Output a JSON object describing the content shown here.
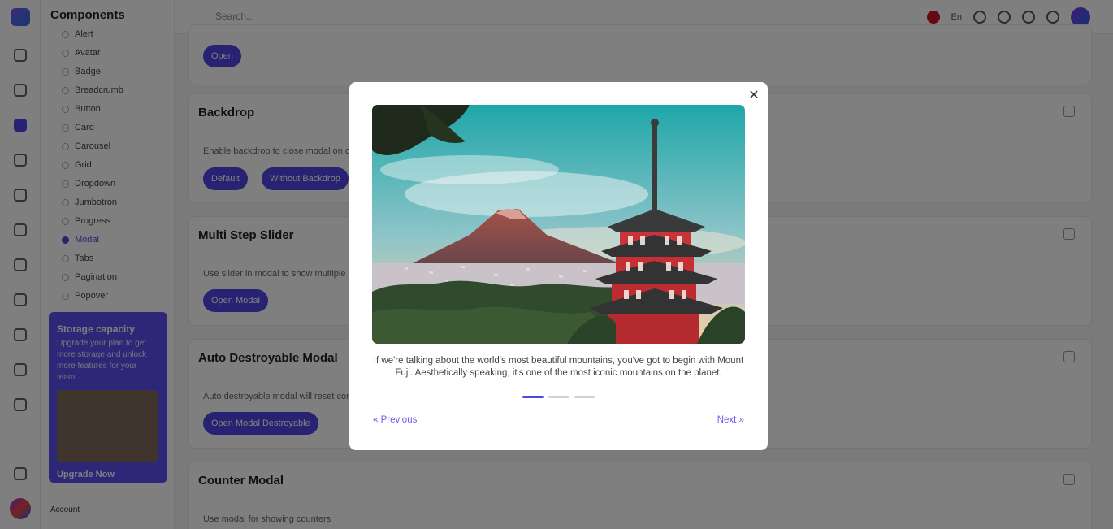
{
  "app": {
    "section_title": "Components"
  },
  "topbar": {
    "search_placeholder": "Search...",
    "language": "En"
  },
  "subnav": {
    "items": [
      "Alert",
      "Avatar",
      "Badge",
      "Breadcrumb",
      "Button",
      "Card",
      "Carousel",
      "Grid",
      "Dropdown",
      "Jumbotron",
      "Progress",
      "Modal",
      "Tabs",
      "Pagination",
      "Popover"
    ],
    "active_index": 11
  },
  "promo": {
    "title": "Storage capacity",
    "text": "Upgrade your plan to get more storage and unlock more features for your team.",
    "link": "Upgrade Now"
  },
  "profile": {
    "name": "Account"
  },
  "cards": [
    {
      "title": "",
      "desc": "",
      "buttons": [
        "Open"
      ]
    },
    {
      "title": "Backdrop",
      "desc": "Enable backdrop to close modal on outside click",
      "buttons": [
        "Default",
        "Without Backdrop"
      ]
    },
    {
      "title": "Multi Step Slider",
      "desc": "Use slider in modal to show multiple steps content",
      "buttons": [
        "Open Modal"
      ]
    },
    {
      "title": "Auto Destroyable Modal",
      "desc": "Auto destroyable modal will reset content on close",
      "buttons": [
        "Open Modal Destroyable"
      ]
    },
    {
      "title": "Counter Modal",
      "desc": "Use modal for showing counters",
      "buttons": []
    }
  ],
  "modal": {
    "close_icon": "close-icon",
    "image_alt": "Mount Fuji with Chureito Pagoda",
    "caption": "If we're talking about the world's most beautiful mountains, you've got to begin with Mount Fuji. Aesthetically speaking, it's one of the most iconic mountains on the planet.",
    "step_total": 3,
    "step_current": 1,
    "prev_label": "Previous",
    "next_label": "Next",
    "prev_icon": "double-chevron-left-icon",
    "next_icon": "double-chevron-right-icon"
  },
  "colors": {
    "accent": "#4f46e5",
    "link": "#6d5df0",
    "overlay": "rgba(0,0,0,0.5)"
  }
}
